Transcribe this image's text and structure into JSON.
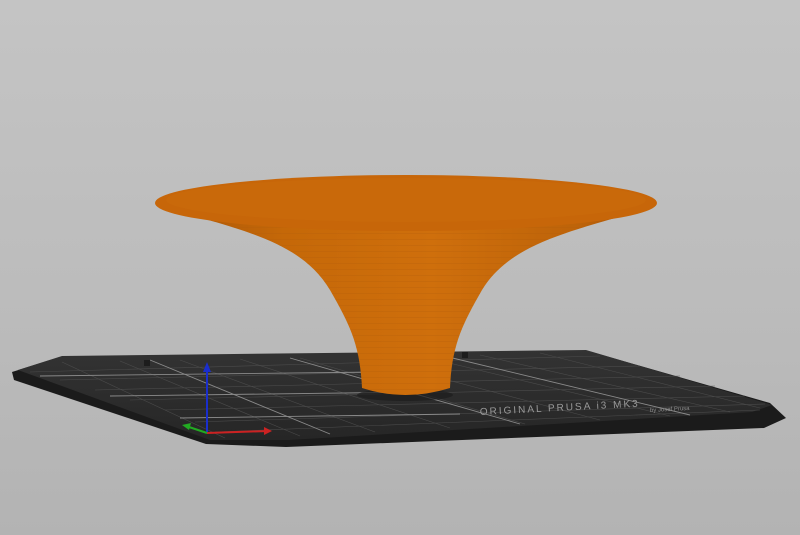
{
  "viewport": {
    "background_color": "#c0c0c0"
  },
  "print_bed": {
    "label": "ORIGINAL PRUSA i3 MK3",
    "sublabel": "by Josef Prusa",
    "surface_color": "#2b2b2b",
    "grid_color": "#5a5a5a"
  },
  "model": {
    "shape": "funnel / trumpet vase",
    "color": "#c86a0a",
    "top_color": "#c76609"
  },
  "axes": {
    "x_color": "#cc2222",
    "y_color": "#22aa22",
    "z_color": "#1a2ecc"
  }
}
